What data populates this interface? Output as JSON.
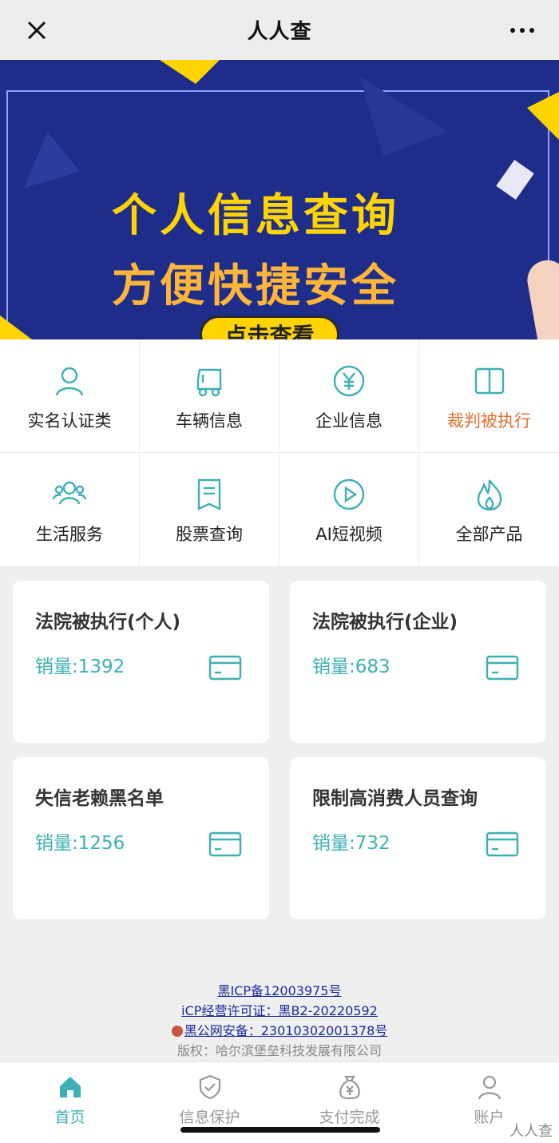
{
  "topbar": {
    "title": "人人查",
    "close_icon": "close-icon",
    "more_icon": "more-icon"
  },
  "banner": {
    "line1": "个人信息查询",
    "line2": "方便快捷安全",
    "cta": "点击查看",
    "slide_count": 3,
    "active_slide": 1,
    "colors": {
      "background": "#1f2d8a",
      "line1": "#ffd400",
      "line2": "#ffb638",
      "cta": "#ffd400"
    }
  },
  "grid": {
    "items": [
      {
        "label": "实名认证类",
        "icon": "user-icon"
      },
      {
        "label": "车辆信息",
        "icon": "vehicle-icon"
      },
      {
        "label": "企业信息",
        "icon": "yen-icon"
      },
      {
        "label": "裁判被执行",
        "icon": "book-icon",
        "highlight": true
      },
      {
        "label": "生活服务",
        "icon": "group-icon"
      },
      {
        "label": "股票查询",
        "icon": "document-icon"
      },
      {
        "label": "AI短视频",
        "icon": "play-icon"
      },
      {
        "label": "全部产品",
        "icon": "flame-icon"
      }
    ],
    "colors": {
      "icon": "#3cb0b5",
      "highlight": "#e07030"
    }
  },
  "cards": [
    {
      "title": "法院被执行(个人)",
      "sales": "销量:1392",
      "icon": "card-icon"
    },
    {
      "title": "法院被执行(企业)",
      "sales": "销量:683",
      "icon": "card-icon"
    },
    {
      "title": "失信老赖黑名单",
      "sales": "销量:1256",
      "icon": "card-icon"
    },
    {
      "title": "限制高消费人员查询",
      "sales": "销量:732",
      "icon": "card-icon"
    }
  ],
  "footer": {
    "icp": "黑ICP备12003975号",
    "license": "iCP经营许可证：黑B2-20220592",
    "police": "黑公网安备：23010302001378号",
    "copyright": "版权：哈尔滨堡垒科技发展有限公司"
  },
  "tabbar": {
    "items": [
      {
        "label": "首页",
        "icon": "home-icon",
        "active": true
      },
      {
        "label": "信息保护",
        "icon": "shield-check-icon",
        "active": false
      },
      {
        "label": "支付完成",
        "icon": "money-bag-icon",
        "active": false
      },
      {
        "label": "账户",
        "icon": "account-icon",
        "active": false
      }
    ],
    "colors": {
      "active": "#3cb0b5",
      "inactive": "#999999"
    }
  },
  "watermark": "人人查"
}
